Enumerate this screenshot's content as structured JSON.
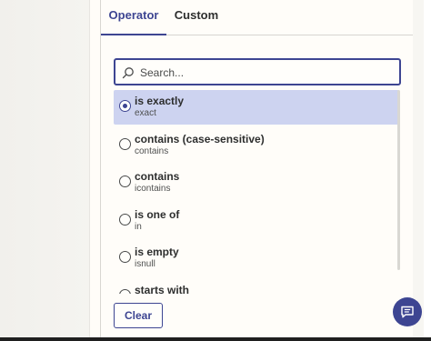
{
  "tabs": [
    {
      "label": "Operator",
      "active": true
    },
    {
      "label": "Custom",
      "active": false
    }
  ],
  "search": {
    "placeholder": "Search...",
    "value": "",
    "icon": "search-icon"
  },
  "options": [
    {
      "label": "is exactly",
      "sub": "exact",
      "selected": true
    },
    {
      "label": "contains (case-sensitive)",
      "sub": "contains",
      "selected": false
    },
    {
      "label": "contains",
      "sub": "icontains",
      "selected": false
    },
    {
      "label": "is one of",
      "sub": "in",
      "selected": false
    },
    {
      "label": "is empty",
      "sub": "isnull",
      "selected": false
    },
    {
      "label": "starts with",
      "sub": "",
      "selected": false
    }
  ],
  "footer": {
    "clear_label": "Clear"
  },
  "chat": {
    "icon": "chat-icon"
  },
  "colors": {
    "accent": "#3d4592",
    "selected_bg": "#cdd3f0",
    "text": "#2d2e2e"
  }
}
